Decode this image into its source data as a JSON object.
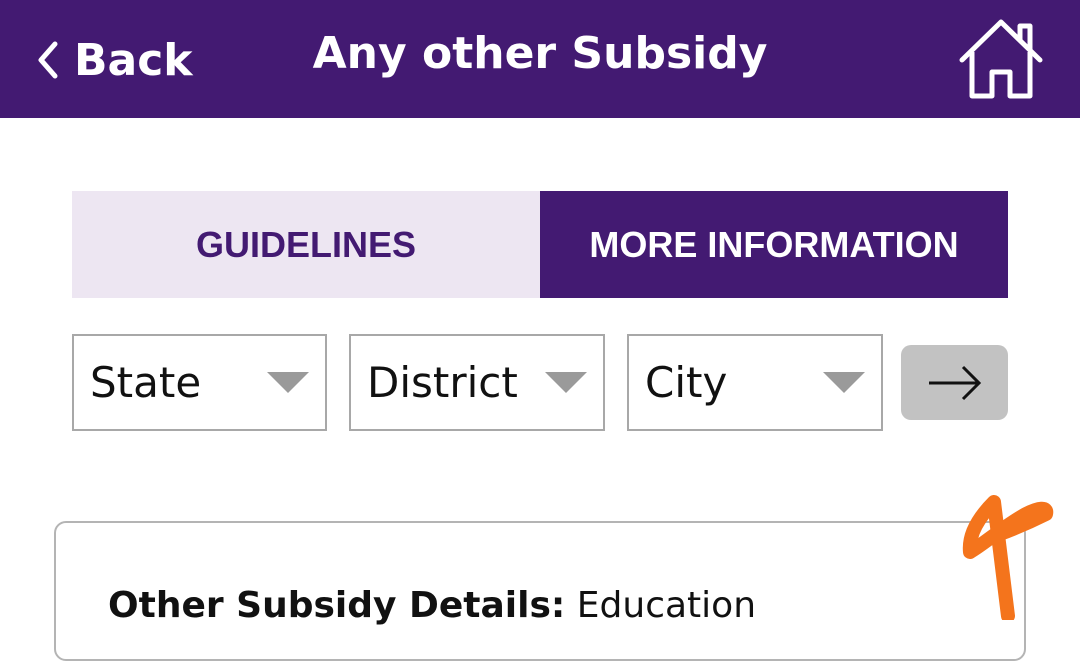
{
  "header": {
    "back_label": "Back",
    "title": "Any other Subsidy",
    "home_icon": "home-icon",
    "background": "#431a72"
  },
  "tabs": [
    {
      "label": "GUIDELINES",
      "selected": false
    },
    {
      "label": "MORE INFORMATION",
      "selected": true
    }
  ],
  "filters": {
    "state": "State",
    "district": "District",
    "city": "City",
    "go_icon": "arrow-right-icon"
  },
  "card": {
    "label": "Other Subsidy Details",
    "separator": ":",
    "value": "Education"
  },
  "colors": {
    "primary": "#431a72",
    "tab_inactive_bg": "#ede6f2",
    "annotation": "#f4741c"
  }
}
